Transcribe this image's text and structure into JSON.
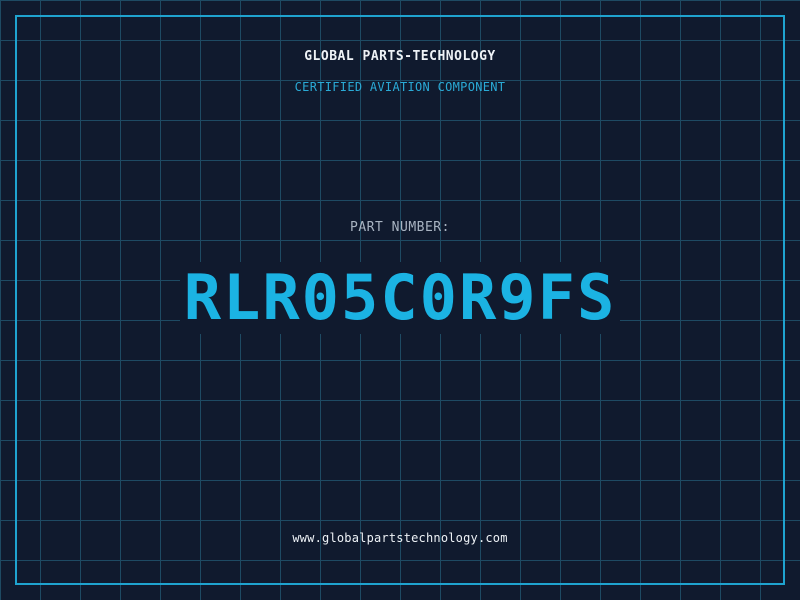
{
  "header": {
    "company": "GLOBAL PARTS-TECHNOLOGY",
    "subtitle": "CERTIFIED AVIATION COMPONENT"
  },
  "part": {
    "label": "PART NUMBER:",
    "number": "RLR05C0R9FS"
  },
  "footer": {
    "url": "www.globalpartstechnology.com"
  },
  "colors": {
    "background": "#101a2e",
    "grid": "#1e4a63",
    "accent": "#1bb3e3",
    "text": "#eef2f6"
  }
}
